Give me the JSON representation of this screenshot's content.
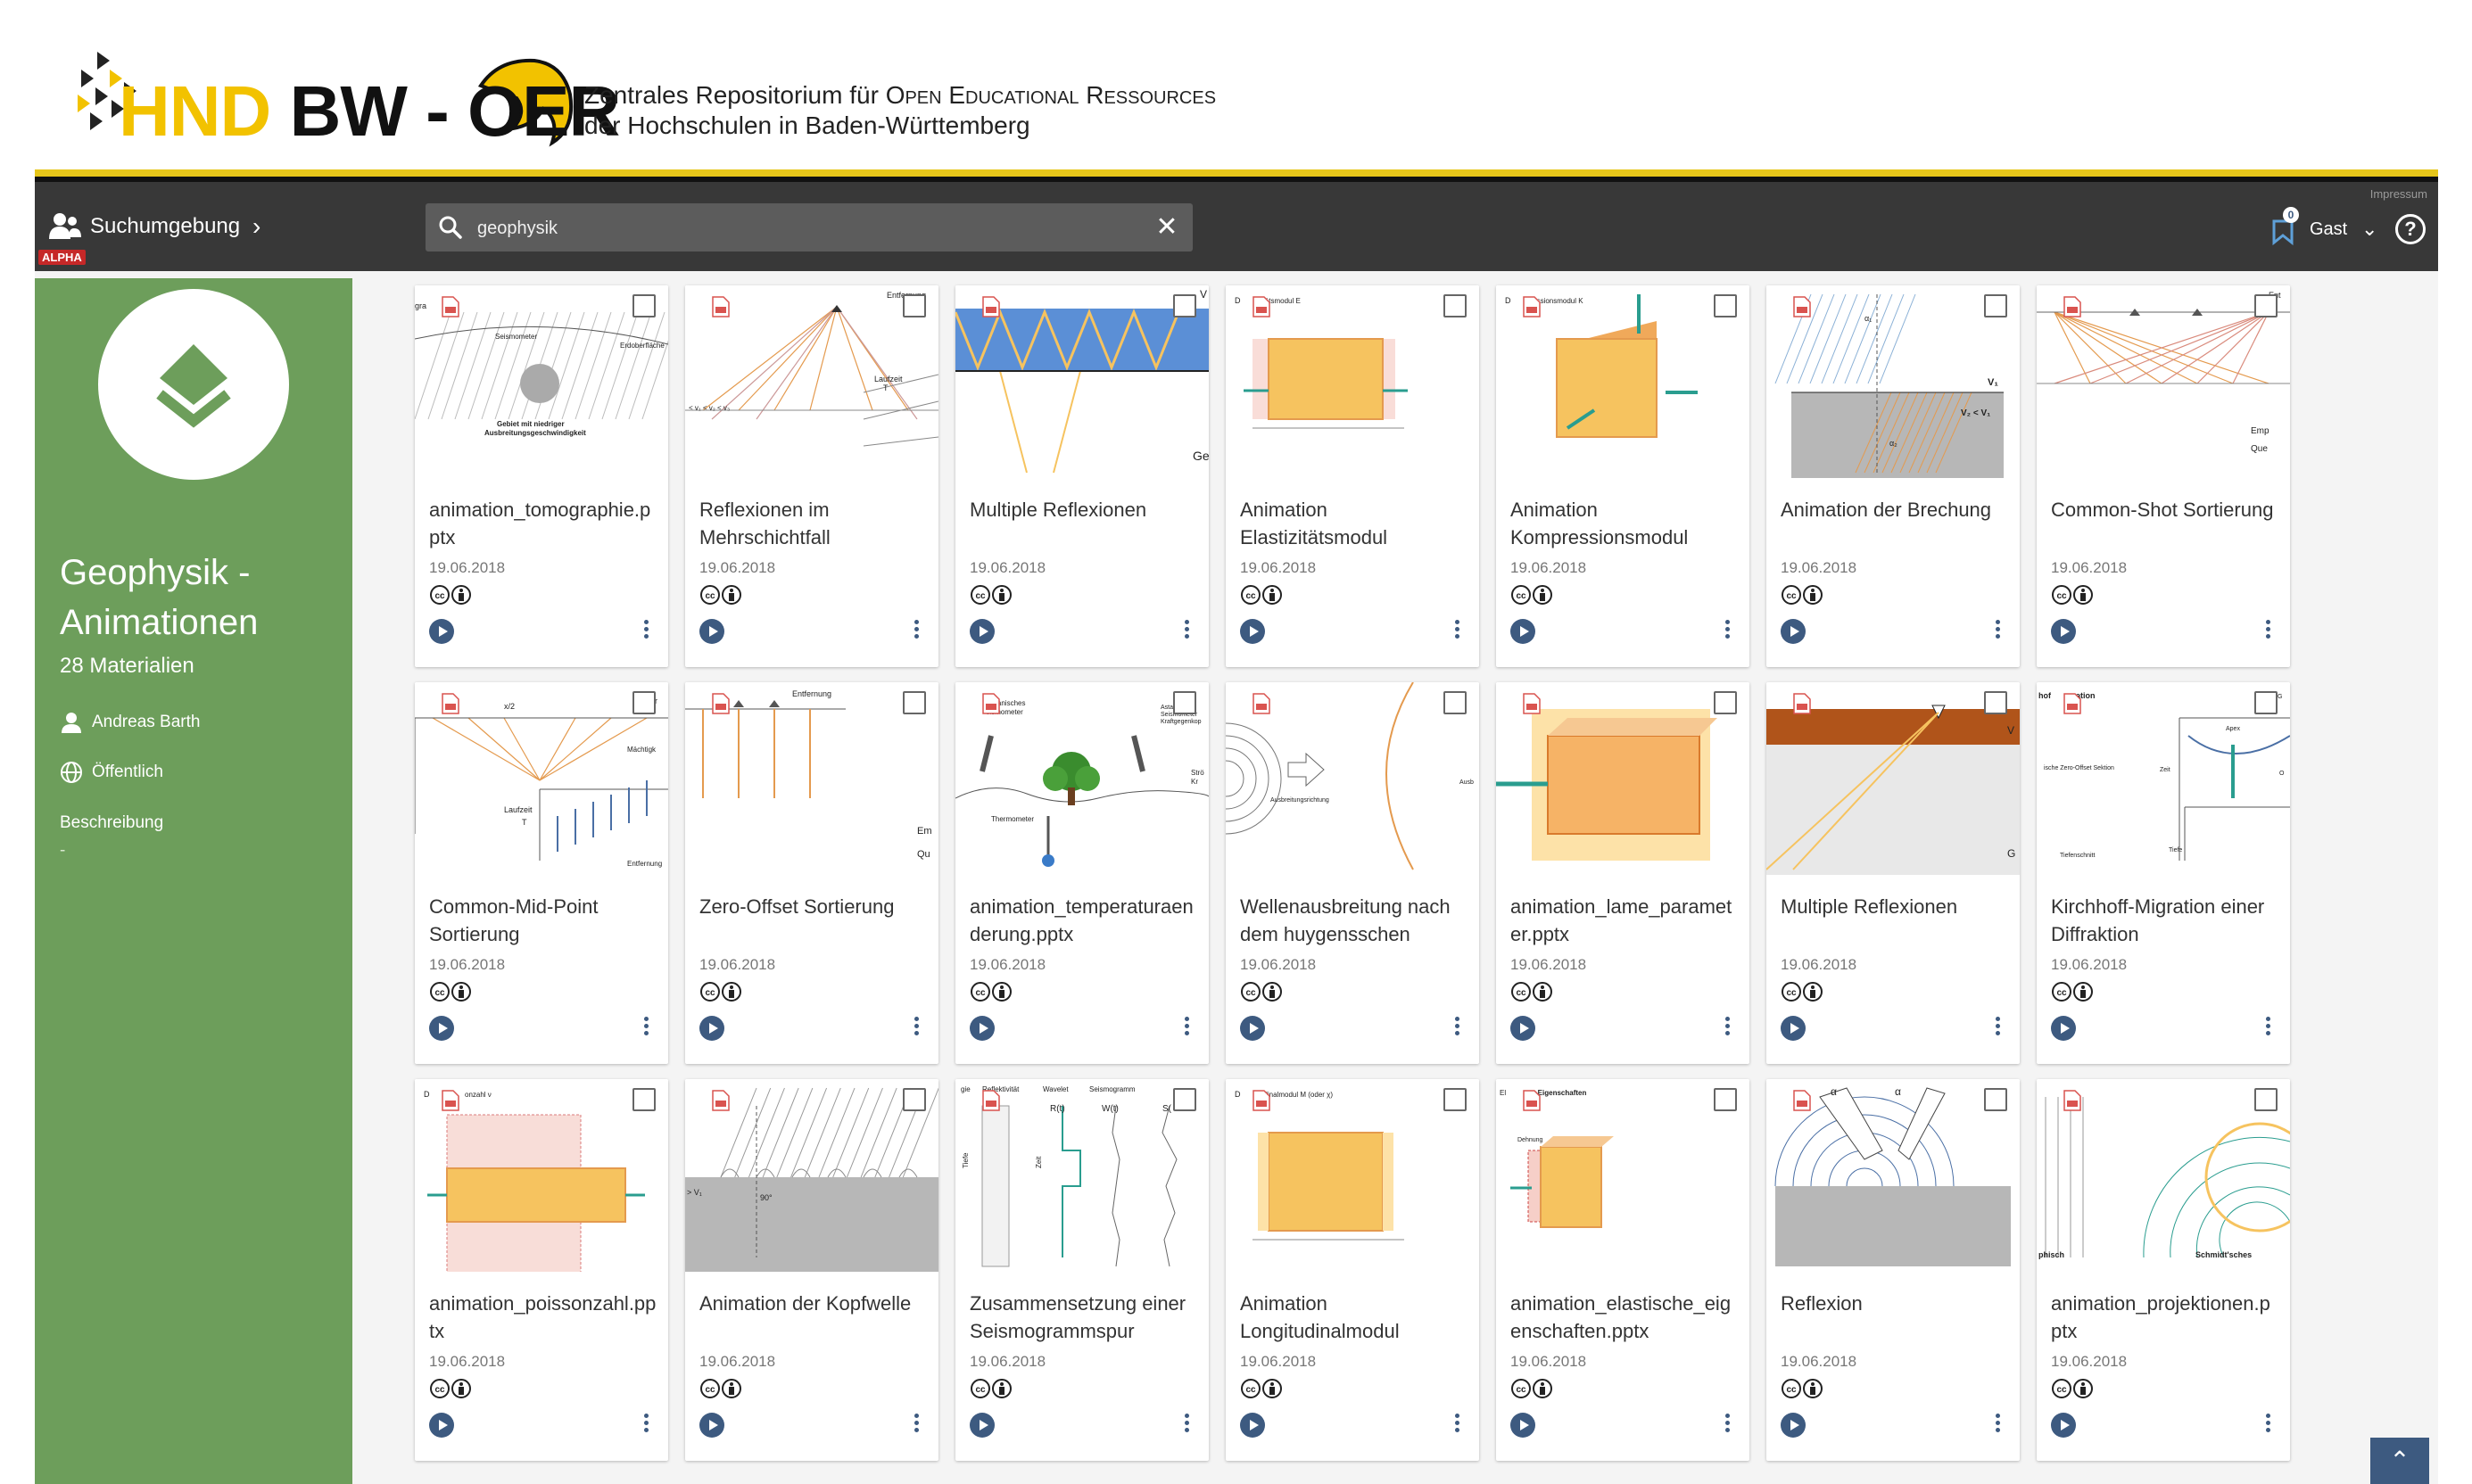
{
  "header": {
    "logo_hnd": "HND",
    "logo_bw": "BW - OER",
    "tagline_line1_prefix": "Zentrales Repositorium für ",
    "tagline_line1_sc": "Open Educational Ressources",
    "tagline_line2": "der Hochschulen in Baden-Württemberg"
  },
  "toolbar": {
    "alpha_badge": "ALPHA",
    "search_env_label": "Suchumgebung",
    "search_value": "geophysik",
    "impressum": "Impressum",
    "cart_count": "0",
    "user_label": "Gast"
  },
  "sidebar": {
    "title": "Geophysik - Animationen",
    "count": "28 Materialien",
    "author": "Andreas Barth",
    "visibility": "Öffentlich",
    "description_label": "Beschreibung",
    "description": "-"
  },
  "colors": {
    "sidebar_green": "#6d9e5b",
    "toolbar_dark": "#383838",
    "accent_blue": "#3d5a80",
    "logo_yellow": "#f2c200"
  },
  "cards": [
    {
      "title": "animation_tomographie.pptx",
      "date": "19.06.2018",
      "thumb": "tomography",
      "thumb_texts": [
        "gra",
        "Seismometer",
        "Erdoberfläche",
        "Gebiet mit niedriger",
        "Ausbreitungsgeschwindigkeit"
      ]
    },
    {
      "title": "Reflexionen im Mehrschichtfall",
      "date": "19.06.2018",
      "thumb": "multilayer",
      "thumb_texts": [
        "Entfernung",
        "Laufzeit",
        "T",
        "< v₁ < v₂ < v₃"
      ]
    },
    {
      "title": "Multiple Reflexionen",
      "date": "19.06.2018",
      "thumb": "multiple",
      "thumb_texts": [
        "Ge",
        "V"
      ]
    },
    {
      "title": "Animation Elastizitätsmodul",
      "date": "19.06.2018",
      "thumb": "elast",
      "thumb_texts": [
        "D",
        "izitätsmodul E"
      ]
    },
    {
      "title": "Animation Kompressionsmodul",
      "date": "19.06.2018",
      "thumb": "kompr",
      "thumb_texts": [
        "D",
        "pressionsmodul K"
      ]
    },
    {
      "title": "Animation der Brechung",
      "date": "19.06.2018",
      "thumb": "brechung",
      "thumb_texts": [
        "V₁",
        "V₂ < V₁",
        "α₁",
        "α₂"
      ]
    },
    {
      "title": "Common-Shot Sortierung",
      "date": "19.06.2018",
      "thumb": "commonshot",
      "thumb_texts": [
        "Ent",
        "Emp",
        "Que"
      ]
    },
    {
      "title": "Common-Mid-Point Sortierung",
      "date": "19.06.2018",
      "thumb": "cmp",
      "thumb_texts": [
        "x/2",
        "Entfer",
        "Mächtigk",
        "Laufzeit",
        "T",
        "Entfernung"
      ]
    },
    {
      "title": "Zero-Offset Sortierung",
      "date": "19.06.2018",
      "thumb": "zerooffset",
      "thumb_texts": [
        "Entfernung",
        "Em",
        "Qu"
      ]
    },
    {
      "title": "animation_temperaturaenderung.pptx",
      "date": "19.06.2018",
      "thumb": "temperature",
      "thumb_texts": [
        "echanisches",
        "eismometer",
        "Thermometer",
        "Astat",
        "Seismometer",
        "Kraftgegenkop",
        "Strö",
        "Kr"
      ]
    },
    {
      "title": "Wellenausbreitung nach dem huygensschen",
      "date": "19.06.2018",
      "thumb": "huygens",
      "thumb_texts": [
        "Ausbreitungsrichtung",
        "Ausb"
      ]
    },
    {
      "title": "animation_lame_parameter.pptx",
      "date": "19.06.2018",
      "thumb": "lame",
      "thumb_texts": []
    },
    {
      "title": "Multiple Reflexionen",
      "date": "19.06.2018",
      "thumb": "multiple2",
      "thumb_texts": [
        "V",
        "G"
      ]
    },
    {
      "title": "Kirchhoff-Migration einer Diffraktion",
      "date": "19.06.2018",
      "thumb": "kirchhoff",
      "thumb_texts": [
        "hof",
        "ation",
        "ische Zero-Offset Sektion",
        "Tiefenschnitt",
        "Tiefe",
        "Zeit",
        "Apex",
        "G",
        "O"
      ]
    },
    {
      "title": "animation_poissonzahl.pptx",
      "date": "19.06.2018",
      "thumb": "poisson",
      "thumb_texts": [
        "D",
        "onzahl ν"
      ]
    },
    {
      "title": "Animation der Kopfwelle",
      "date": "19.06.2018",
      "thumb": "kopfwelle",
      "thumb_texts": [
        "> V₁",
        "90°"
      ]
    },
    {
      "title": "Zusammensetzung einer Seismogrammspur",
      "date": "19.06.2018",
      "thumb": "seismogram",
      "thumb_texts": [
        "gie",
        "Reflektivität",
        "Wavelet",
        "Seismogramm",
        "R(t)",
        "W(t)",
        "S(",
        "Tiefe",
        "Zeit"
      ]
    },
    {
      "title": "Animation Longitudinalmodul",
      "date": "19.06.2018",
      "thumb": "longit",
      "thumb_texts": [
        "D",
        "itudinalmodul M (oder χ)"
      ]
    },
    {
      "title": "animation_elastische_eigenschaften.pptx",
      "date": "19.06.2018",
      "thumb": "elasteig",
      "thumb_texts": [
        "El",
        "e Eigenschaften",
        "Dehnung"
      ]
    },
    {
      "title": "Reflexion",
      "date": "19.06.2018",
      "thumb": "reflexion",
      "thumb_texts": [
        "α",
        "α"
      ]
    },
    {
      "title": "animation_projektionen.pptx",
      "date": "19.06.2018",
      "thumb": "projektionen",
      "thumb_texts": [
        "phisch",
        "Schmidt'sches"
      ]
    }
  ]
}
